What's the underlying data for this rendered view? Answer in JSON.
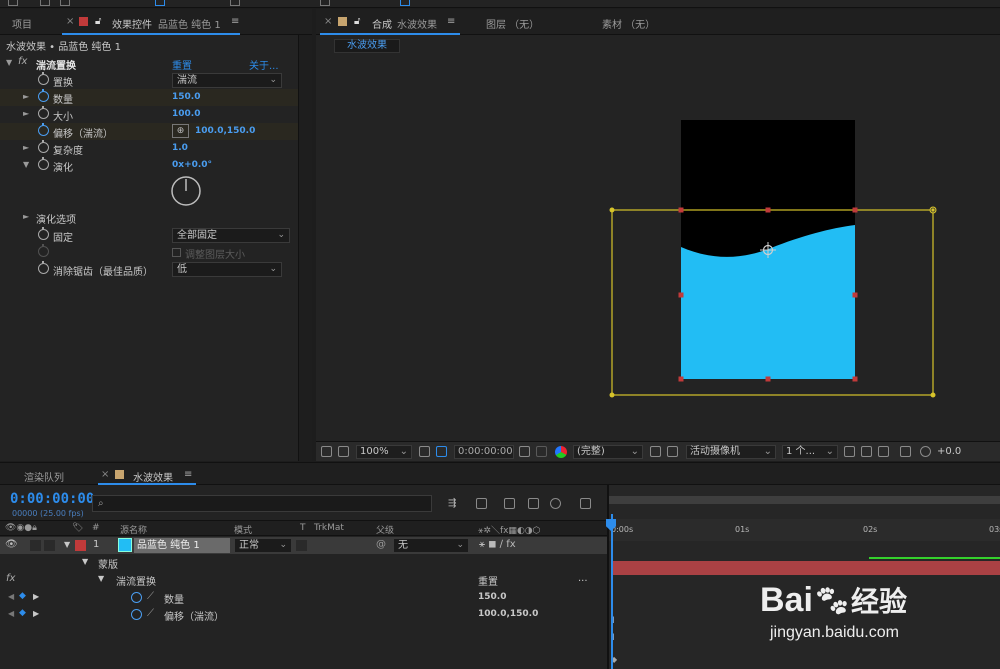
{
  "effect_controls": {
    "tab_project": "项目",
    "tab_prefix": "效果控件",
    "tab_layer": "品蓝色 纯色 1",
    "breadcrumb": "水波效果 • 品蓝色 纯色 1",
    "effect_name": "湍流置换",
    "reset_label": "重置",
    "about_label": "关于...",
    "params": [
      {
        "label": "置换",
        "value": "湍流"
      },
      {
        "label": "数量",
        "value": "150.0"
      },
      {
        "label": "大小",
        "value": "100.0"
      },
      {
        "label": "偏移（湍流）",
        "value": "100.0,150.0"
      },
      {
        "label": "复杂度",
        "value": "1.0"
      },
      {
        "label": "演化",
        "value": "0x+0.0°"
      },
      {
        "label": "演化选项",
        "value": ""
      },
      {
        "label": "固定",
        "value": "全部固定"
      },
      {
        "label": "",
        "value": "调整图层大小"
      },
      {
        "label": "消除锯齿（最佳品质）",
        "value": "低"
      }
    ]
  },
  "composition": {
    "tab_prefix": "合成",
    "tab_name": "水波效果",
    "tab_layer": "图层 （无）",
    "tab_footage": "素材 （无）",
    "subtab": "水波效果",
    "water_color": "#22bdf4",
    "frame_color": "#d6c32a"
  },
  "viewer_toolbar": {
    "zoom": "100%",
    "timecode": "0:00:00:00",
    "resolution": "(完整)",
    "camera": "活动摄像机",
    "views": "1 个...",
    "exposure": "+0.0"
  },
  "timeline": {
    "tab_render_queue": "渲染队列",
    "tab_comp": "水波效果",
    "current_time": "0:00:00:00",
    "fps_info": "00000 (25.00 fps)",
    "columns": {
      "num": "#",
      "source": "源名称",
      "mode": "模式",
      "t": "T",
      "trkmat": "TrkMat",
      "parent": "父级"
    },
    "layer": {
      "index": "1",
      "name": "品蓝色 纯色 1",
      "mode": "正常",
      "parent": "无",
      "color": "#c13a3a"
    },
    "rows": {
      "mask": "蒙版",
      "effect": "湍流置换",
      "reset": "重置",
      "dots": "...",
      "amount_label": "数量",
      "amount_value": "150.0",
      "offset_label": "偏移（湍流）",
      "offset_value": "100.0,150.0"
    },
    "ruler": [
      "0:00s",
      "01s",
      "02s",
      "03s"
    ]
  },
  "watermark": {
    "brand": "Bai",
    "brand2": "经验",
    "url": "jingyan.baidu.com"
  }
}
